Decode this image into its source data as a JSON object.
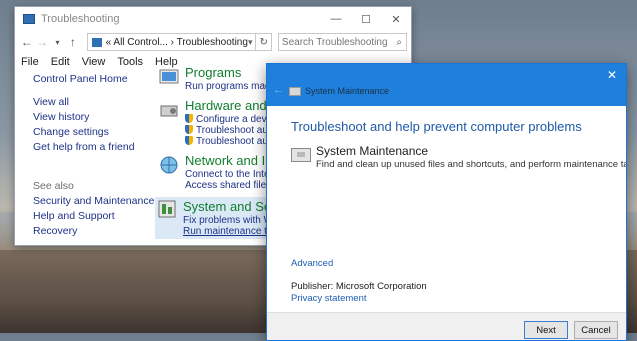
{
  "control_panel": {
    "window_title": "Troubleshooting",
    "window_controls": [
      "—",
      "☐",
      "✕"
    ],
    "address_path": "« All Control...  ›  Troubleshooting",
    "search_placeholder": "Search Troubleshooting",
    "menu": [
      "File",
      "Edit",
      "View",
      "Tools",
      "Help"
    ],
    "left_links": [
      "Control Panel Home",
      "View all",
      "View history",
      "Change settings",
      "Get help from a friend"
    ],
    "see_also_label": "See also",
    "see_also_links": [
      "Security and Maintenance",
      "Help and Support",
      "Recovery"
    ],
    "categories": [
      {
        "title": "Programs",
        "subs": [
          "Run programs made for"
        ]
      },
      {
        "title": "Hardware and Sour",
        "subs": [
          "Configure a device",
          "Troubleshoot audio re",
          "Troubleshoot audio p"
        ]
      },
      {
        "title": "Network and Intern",
        "subs": [
          "Connect to the Internet",
          "Access shared files and fo"
        ]
      },
      {
        "title": "System and Securit",
        "subs": [
          "Fix problems with Windo",
          "Run maintenance tasks"
        ]
      }
    ]
  },
  "troubleshooter": {
    "header_title": "System Maintenance",
    "close_label": "✕",
    "heading": "Troubleshoot and help prevent computer problems",
    "item_title": "System Maintenance",
    "item_description": "Find and clean up unused files and shortcuts, and perform maintenance tasks.",
    "advanced_link": "Advanced",
    "publisher_label": "Publisher:",
    "publisher_value": "Microsoft Corporation",
    "privacy_link": "Privacy statement",
    "next_button": "Next",
    "cancel_button": "Cancel"
  },
  "colors": {
    "dialog_header": "#1e80dc",
    "category_green": "#127d2e",
    "link_blue": "#1e3287",
    "heading_blue": "#1f5aa8"
  }
}
